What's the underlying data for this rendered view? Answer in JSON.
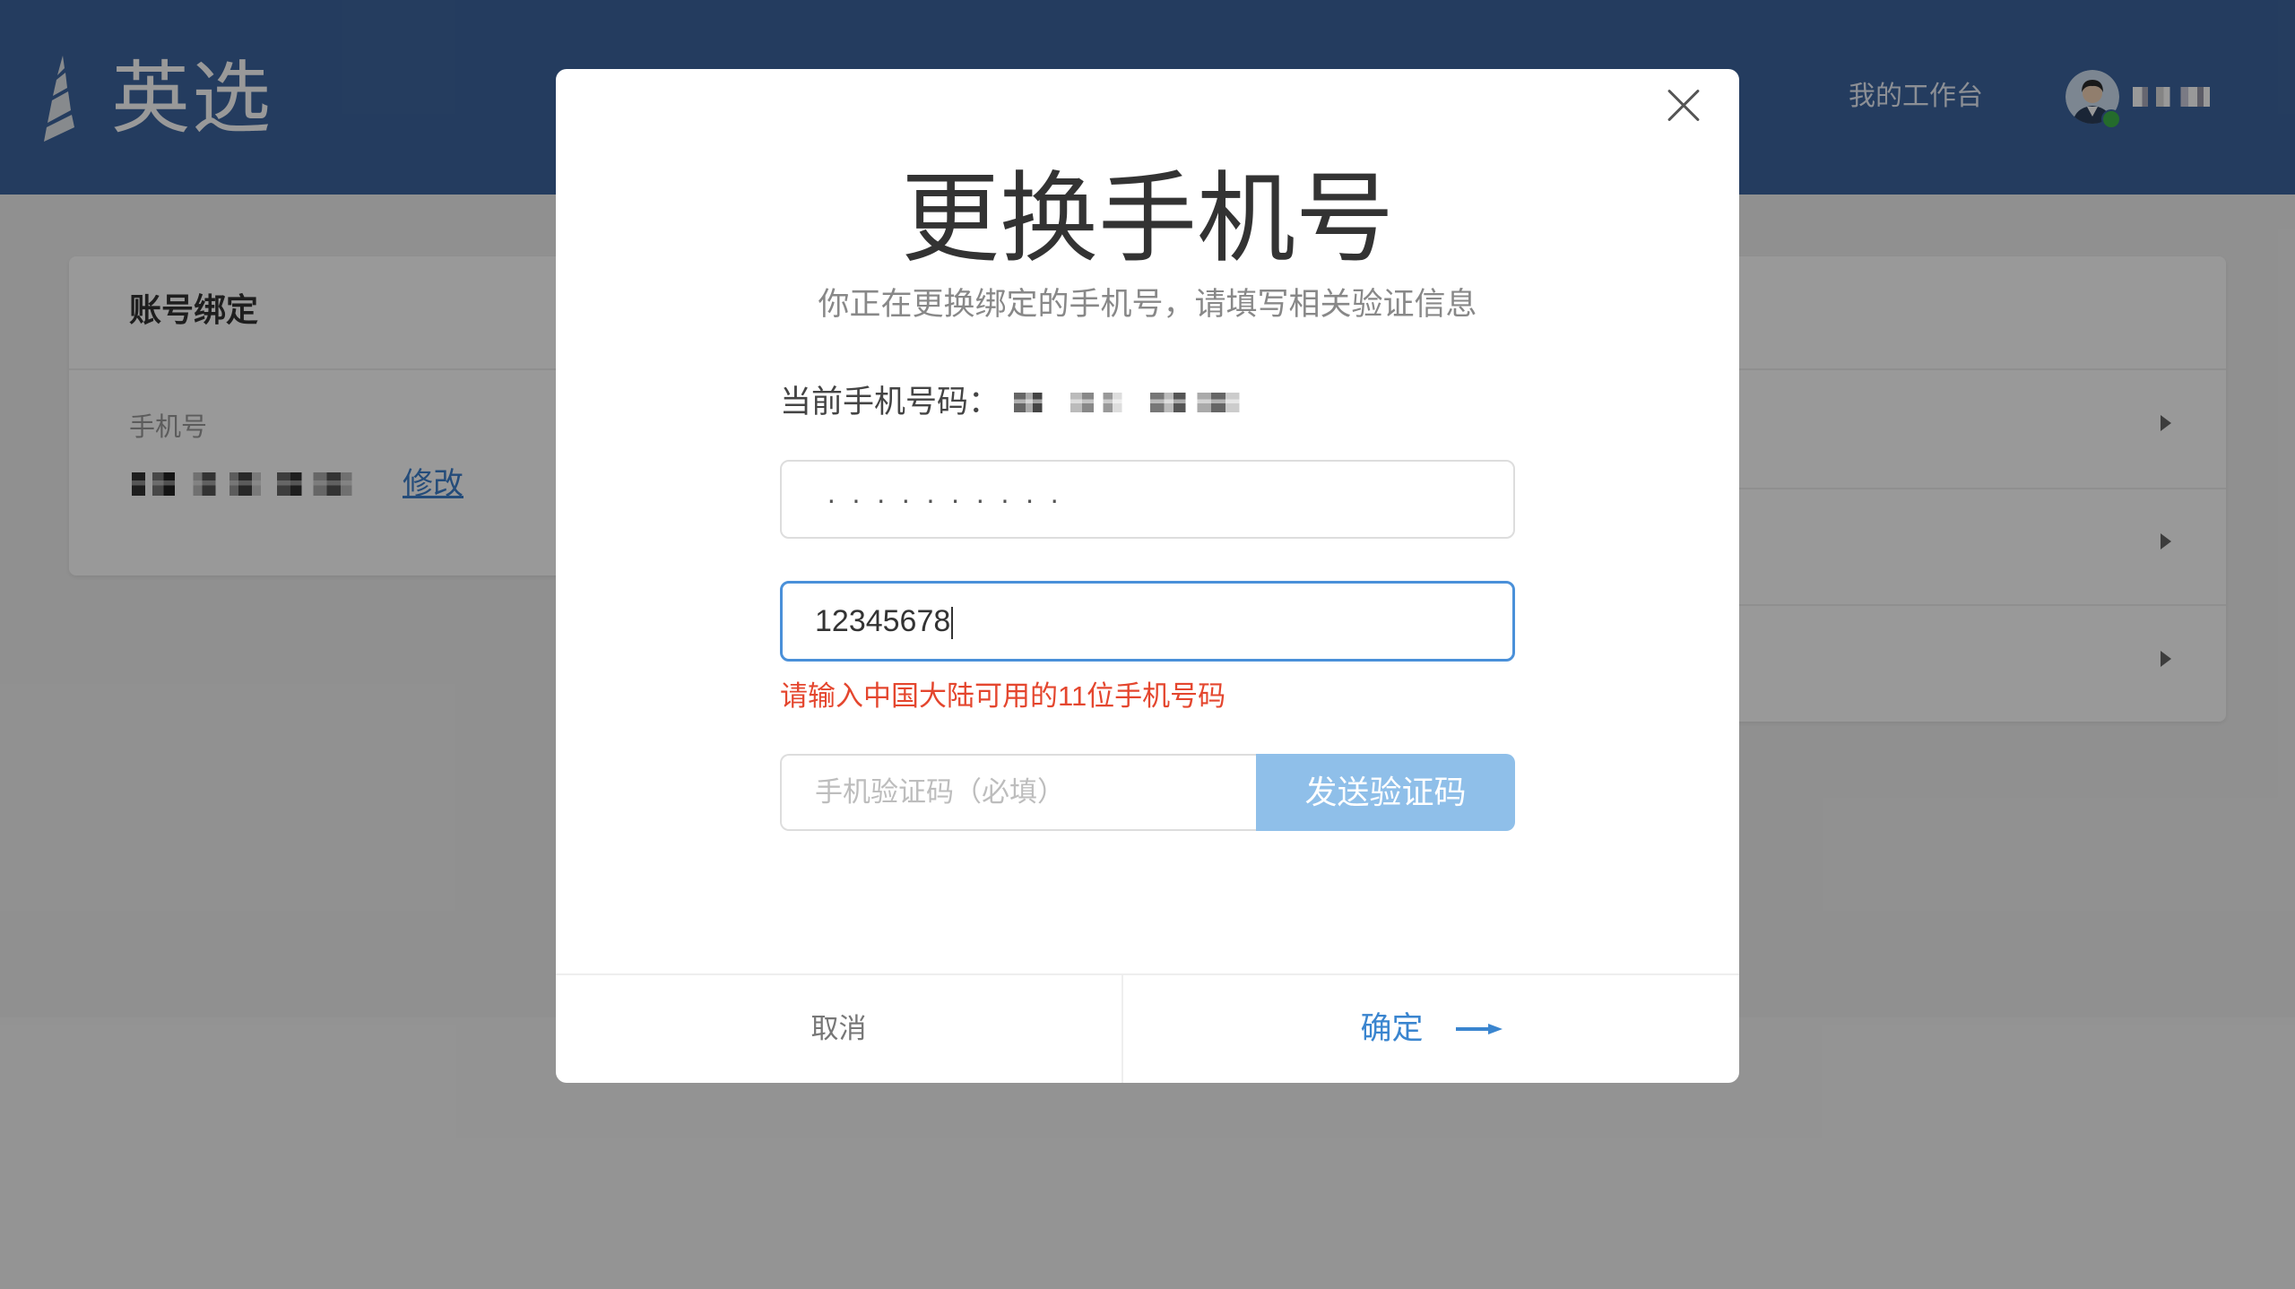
{
  "header": {
    "logo_text": "英选",
    "nav_workbench": "我的工作台"
  },
  "account_card": {
    "title": "账号绑定",
    "phone_label": "手机号",
    "edit_link": "修改"
  },
  "modal": {
    "title": "更换手机号",
    "subtitle": "你正在更换绑定的手机号，请填写相关验证信息",
    "current_phone_label": "当前手机号码：",
    "password_field": {
      "value": "··········"
    },
    "phone_field": {
      "value": "12345678"
    },
    "error_message": "请输入中国大陆可用的11位手机号码",
    "code_field": {
      "placeholder": "手机验证码（必填）"
    },
    "send_code_button": "发送验证码",
    "cancel_button": "取消",
    "confirm_button": "确定"
  },
  "icons": {
    "logo": "sail-logo-icon",
    "close": "close-icon",
    "avatar": "user-avatar-icon",
    "row_arrow": "caret-right-icon",
    "confirm_arrow": "arrow-right-icon"
  },
  "colors": {
    "header": "#3d659e",
    "accent": "#4a90d9",
    "error": "#e4462e",
    "send_button_disabled": "#8fbfe9",
    "confirm_text": "#3a85cf",
    "online_status": "#3cb34a"
  }
}
